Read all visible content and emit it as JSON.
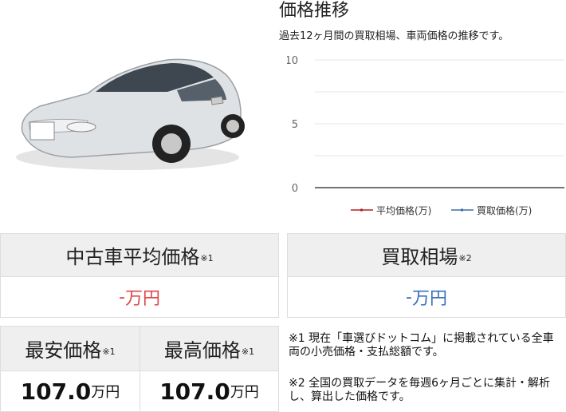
{
  "chart_title": "価格推移",
  "chart_subtitle": "過去12ヶ月間の買取相場、車両価格の推移です。",
  "chart_data": {
    "type": "line",
    "y_ticks": [
      "10",
      "5",
      "0"
    ],
    "ylim": [
      0,
      10
    ],
    "grid": true,
    "legend_position": "bottom",
    "series": [
      {
        "name": "平均価格(万)",
        "color": "#b02020",
        "values": []
      },
      {
        "name": "買取価格(万)",
        "color": "#3a6ea5",
        "values": []
      }
    ]
  },
  "avg_price": {
    "label": "中古車平均価格",
    "note": "※1",
    "value": "-",
    "unit": "万円",
    "color": "#e0474c"
  },
  "buy_price": {
    "label": "買取相場",
    "note": "※2",
    "value": "-",
    "unit": "万円",
    "color": "#3a70c0"
  },
  "min_price": {
    "label": "最安価格",
    "note": "※1",
    "value": "107.0",
    "unit": "万円"
  },
  "max_price": {
    "label": "最高価格",
    "note": "※1",
    "value": "107.0",
    "unit": "万円"
  },
  "notes": [
    "※1 現在「車選びドットコム」に掲載されている全車両の小売価格・支払総額です。",
    "※2 全国の買取データを毎週6ヶ月ごとに集計・解析し、算出した価格です。"
  ]
}
